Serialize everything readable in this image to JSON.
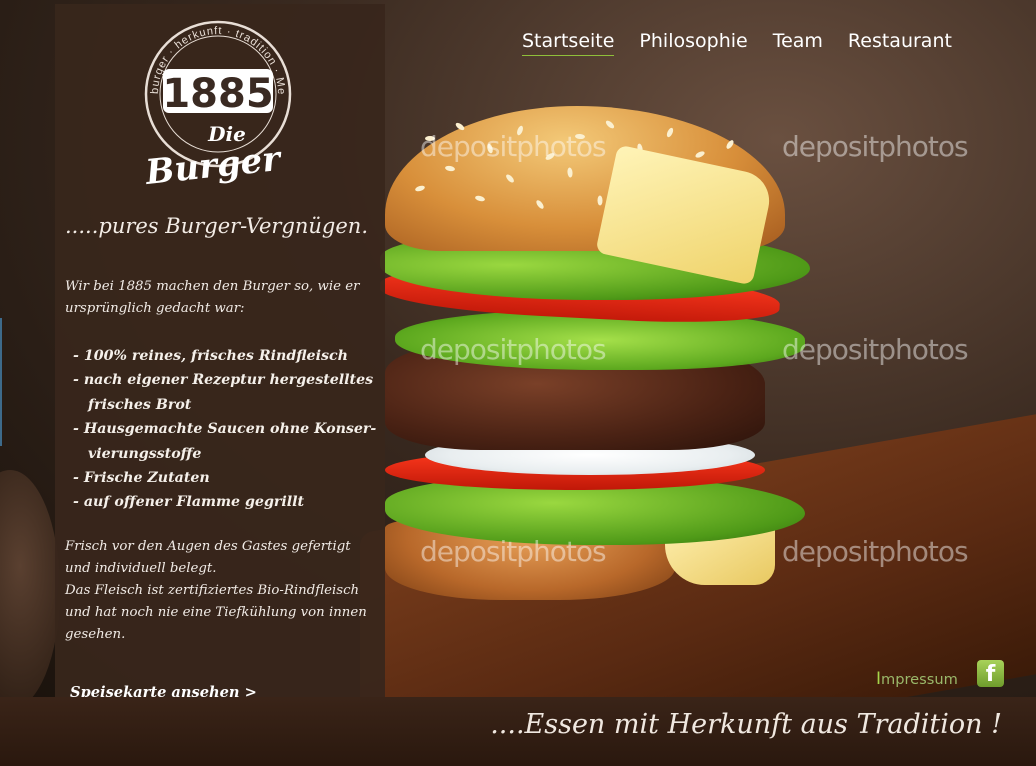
{
  "nav": {
    "items": [
      {
        "label": "Startseite",
        "active": true
      },
      {
        "label": "Philosophie",
        "active": false
      },
      {
        "label": "Team",
        "active": false
      },
      {
        "label": "Restaurant",
        "active": false
      }
    ],
    "active_underline_color": "#8fbf3a"
  },
  "logo": {
    "number": "1885",
    "script_top": "Die",
    "script_bottom": "Burger",
    "ring_text": "burger · herkunft · tradition · Me … tur"
  },
  "panel": {
    "tagline": ".....pures Burger-Vergnügen.",
    "intro": "Wir bei 1885 machen den Burger so, wie er ursprünglich gedacht war:",
    "features": [
      "- 100% reines, frisches Rindfleisch",
      "- nach eigener Rezeptur hergestelltes frisches Brot",
      "- Hausgemachte Saucen ohne Konser- vierungsstoffe",
      "- Frische Zutaten",
      "- auf offener Flamme gegrillt"
    ],
    "desc_1": "Frisch vor den Augen des Gastes gefertigt und individuell belegt.",
    "desc_2": "Das Fleisch ist zertifiziertes Bio-Rindfleisch und hat noch nie eine Tiefkühlung von innen gesehen.",
    "menu_link": "Speisekarte ansehen >"
  },
  "impressum": {
    "first_letter": "I",
    "rest": "mpressum",
    "color": "#a6d54a"
  },
  "facebook": {
    "icon": "facebook-icon",
    "glyph": "f"
  },
  "footer": {
    "text": "....Essen mit Herkunft aus Tradition !"
  },
  "watermark": {
    "text": "depositphotos"
  },
  "colors": {
    "panel_bg": "#38261c",
    "footer_bg": "#2a180e",
    "accent_green": "#8fbf3a"
  }
}
